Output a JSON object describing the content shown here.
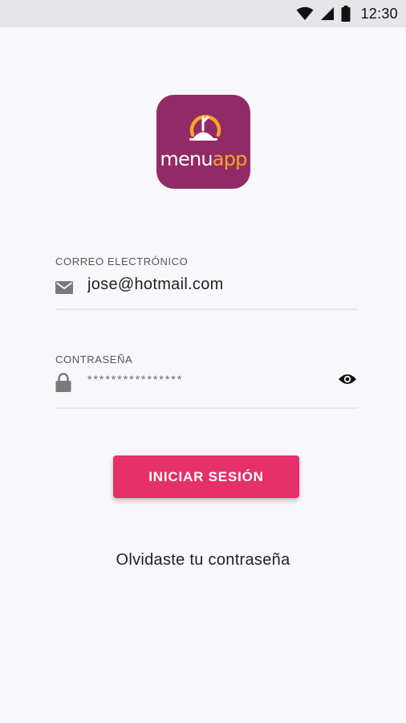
{
  "status_bar": {
    "time": "12:30",
    "icons": [
      "wifi-icon",
      "signal-icon",
      "battery-icon"
    ]
  },
  "logo": {
    "text_main": "menu",
    "text_accent": "app",
    "colors": {
      "background": "#922a67",
      "accent": "#f5a623"
    }
  },
  "email_field": {
    "label": "CORREO ELECTRÓNICO",
    "value": "jose@hotmail.com",
    "icon": "envelope-icon"
  },
  "password_field": {
    "label": "CONTRASEÑA",
    "value": "****************",
    "icon": "lock-icon",
    "toggle_icon": "eye-icon"
  },
  "login_button": {
    "label": "INICIAR SESIÓN",
    "color": "#e5306a"
  },
  "forgot_link": {
    "label": "Olvidaste tu contraseña"
  }
}
